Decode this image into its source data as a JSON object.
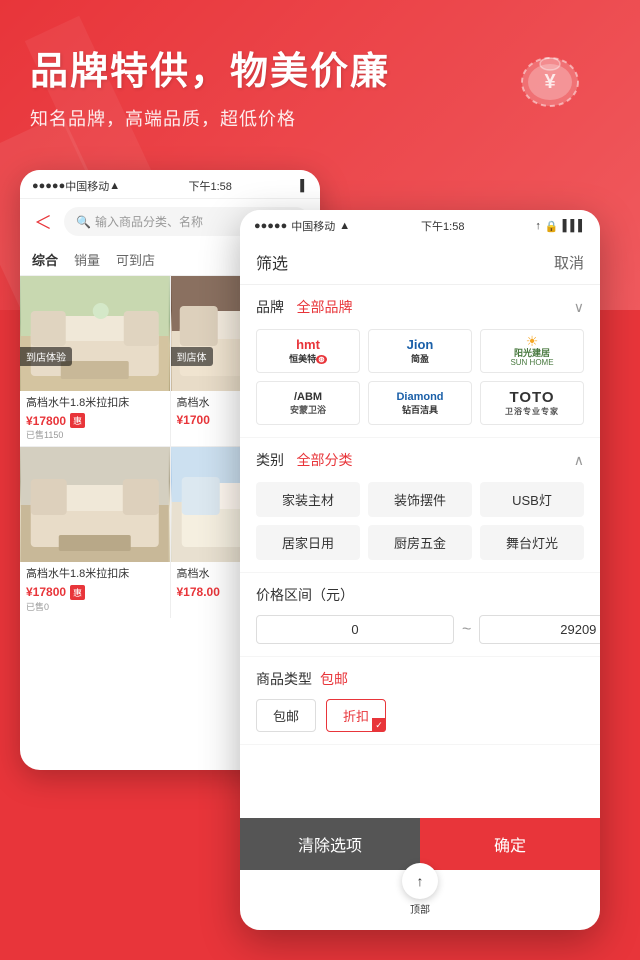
{
  "banner": {
    "title": "品牌特供，物美价廉",
    "subtitle": "知名品牌，高端品质，超低价格"
  },
  "back_phone": {
    "status": {
      "carrier": "中国移动",
      "wifi": "WiFi",
      "time": "下午1:58"
    },
    "search_placeholder": "输入商品分类、名称",
    "tabs": [
      "综合",
      "销量",
      "可到店"
    ],
    "products": [
      {
        "name": "高档水牛1.8米拉扣床",
        "price": "¥17800",
        "badge": "惠",
        "sold": "已售1150",
        "visit": "到店体验"
      },
      {
        "name": "高档水",
        "price": "¥1700",
        "visit": "到店体"
      },
      {
        "name": "高档水牛1.8米拉扣床",
        "price": "¥17800",
        "badge": "惠",
        "sold": "已售0"
      },
      {
        "name": "高档水",
        "price": "¥178.00"
      }
    ]
  },
  "front_phone": {
    "status": {
      "carrier": "中国移动",
      "wifi": "WiFi",
      "time": "下午1:58"
    },
    "filter_title": "筛选",
    "cancel_label": "取消",
    "brand_section": {
      "label": "品牌",
      "value": "全部品牌",
      "collapsed": true,
      "brands": [
        {
          "name": "hmt恒美特",
          "class": "hmt"
        },
        {
          "name": "Jion简盈",
          "class": "jion"
        },
        {
          "name": "阳光建居 SUN HOME",
          "class": "sun"
        },
        {
          "name": "ABM安蒙卫浴",
          "class": "abm"
        },
        {
          "name": "Diamond 钻百洁具",
          "class": "diamond"
        },
        {
          "name": "TOTO",
          "class": "toto"
        }
      ]
    },
    "category_section": {
      "label": "类别",
      "value": "全部分类",
      "expanded": true,
      "categories": [
        "家装主材",
        "装饰摆件",
        "USB灯",
        "居家日用",
        "厨房五金",
        "舞台灯光"
      ]
    },
    "price_section": {
      "label": "价格区间（元）",
      "min": "0",
      "max": "29209",
      "separator": "~"
    },
    "goods_type_section": {
      "label": "商品类型",
      "value": "包邮",
      "options": [
        {
          "label": "包邮",
          "selected": false
        },
        {
          "label": "折扣",
          "selected": true
        }
      ]
    },
    "btn_clear": "清除选项",
    "btn_confirm": "确定",
    "scroll_top": "顶部"
  }
}
